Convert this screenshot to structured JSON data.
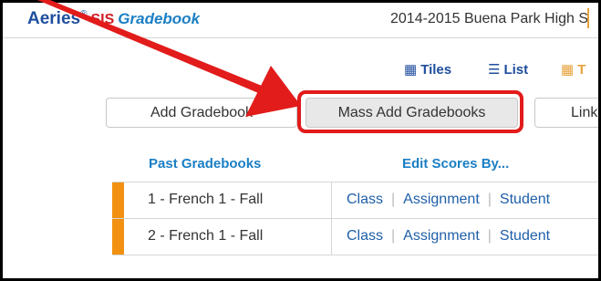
{
  "header": {
    "brand_aeries": "Aeries",
    "brand_reg": "®",
    "brand_sis": "SIS",
    "brand_gradebook": "Gradebook",
    "school_text": "2014-2015 Buena Park High S"
  },
  "views": {
    "tiles_icon": "grid-icon",
    "tiles_label": "Tiles",
    "list_icon": "list-icon",
    "list_label": "List",
    "tab_icon": "table-icon",
    "tab_label": "T"
  },
  "actions": {
    "add_gradebook": "Add Gradebook",
    "mass_add_gradebooks": "Mass Add Gradebooks",
    "link_partial": "Link"
  },
  "table": {
    "col_past": "Past Gradebooks",
    "col_edit": "Edit Scores By...",
    "rows": [
      {
        "name": "1 - French 1 - Fall",
        "link1": "Class",
        "link2": "Assignment",
        "link3": "Student"
      },
      {
        "name": "2 - French 1 - Fall",
        "link1": "Class",
        "link2": "Assignment",
        "link3": "Student"
      }
    ]
  },
  "colors": {
    "highlight": "#e21b1b",
    "row_swatch": "#f29111",
    "link": "#1f5fa8",
    "header_text": "#1b7fc4"
  }
}
